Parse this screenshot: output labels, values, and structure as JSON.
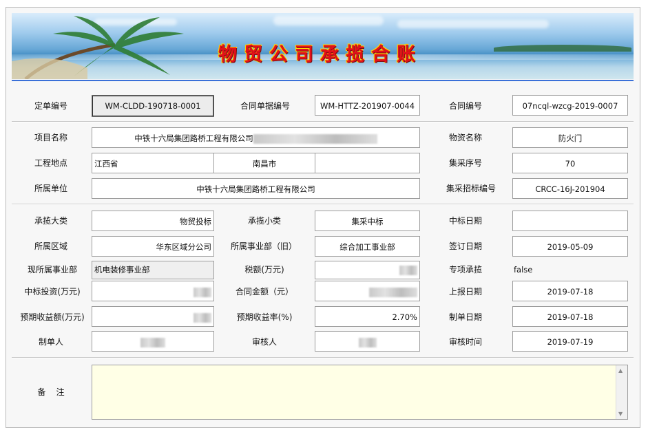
{
  "window": {
    "title": "物贸公司承揽合账"
  },
  "row1": {
    "order_no_label": "定单编号",
    "order_no": "WM-CLDD-190718-0001",
    "contract_doc_label": "合同单据编号",
    "contract_doc": "WM-HTTZ-201907-0044",
    "contract_no_label": "合同编号",
    "contract_no": "07ncql-wzcg-2019-0007"
  },
  "project": {
    "name_label": "项目名称",
    "name": "中铁十六局集团路桥工程有限公司",
    "material_label": "物资名称",
    "material": "防火门",
    "site_label": "工程地点",
    "province": "江西省",
    "city": "南昌市",
    "site_extra": "",
    "seq_label": "集采序号",
    "seq": "70",
    "unit_label": "所属单位",
    "unit": "中铁十六局集团路桥工程有限公司",
    "bid_no_label": "集采招标编号",
    "bid_no": "CRCC-16J-201904"
  },
  "details": {
    "cat_big_label": "承揽大类",
    "cat_big": "物贸投标",
    "cat_small_label": "承揽小类",
    "cat_small": "集采中标",
    "win_date_label": "中标日期",
    "win_date": "",
    "region_label": "所属区域",
    "region": "华东区域分公司",
    "dept_old_label": "所属事业部（旧）",
    "dept_old": "综合加工事业部",
    "sign_date_label": "签订日期",
    "sign_date": "2019-05-09",
    "dept_now_label": "现所属事业部",
    "dept_now": "机电装修事业部",
    "tax_label": "税额(万元)",
    "special_label": "专项承揽",
    "special": "false",
    "invest_label": "中标投资(万元)",
    "amount_label": "合同金额（元）",
    "report_date_label": "上报日期",
    "report_date": "2019-07-18",
    "expected_income_label": "预期收益额(万元)",
    "expected_rate_label": "预期收益率(%)",
    "expected_rate": "2.70%",
    "make_date_label": "制单日期",
    "make_date": "2019-07-18",
    "maker_label": "制单人",
    "auditor_label": "审核人",
    "audit_time_label": "审核时间",
    "audit_time": "2019-07-19"
  },
  "remark": {
    "label": "备    注",
    "value": ""
  },
  "colors": {
    "accent_line": "#3a70d8",
    "title_red": "#e3101a",
    "remark_bg": "#ffffe6"
  }
}
